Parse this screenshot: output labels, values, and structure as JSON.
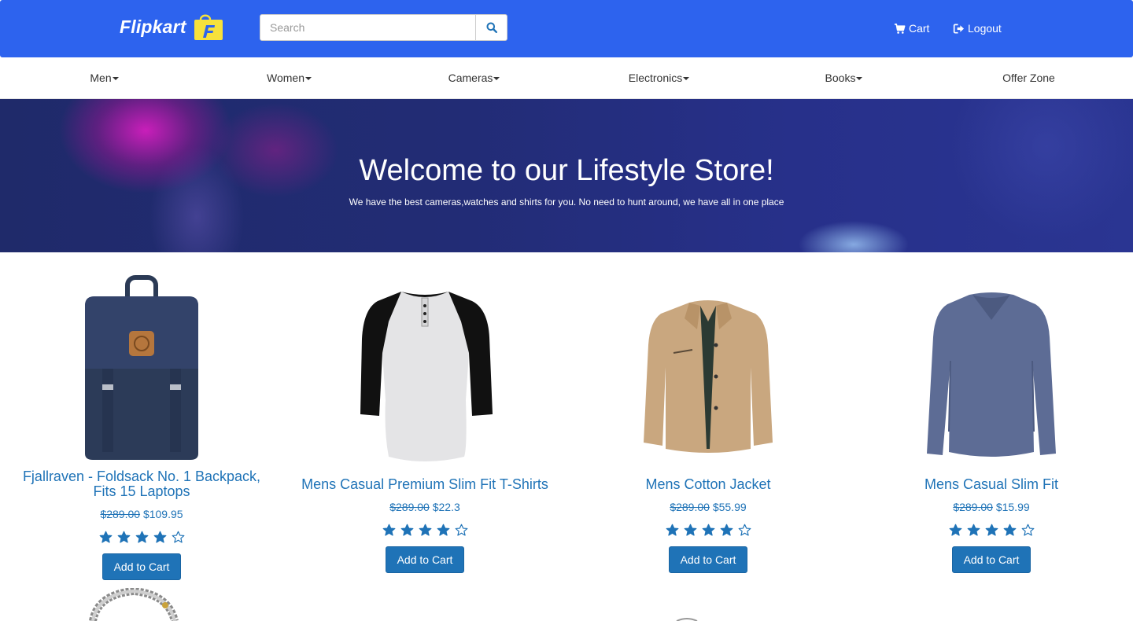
{
  "header": {
    "logo_text": "Flipkart",
    "search_placeholder": "Search",
    "cart_label": "Cart",
    "logout_label": "Logout",
    "brand_color": "#2d63ee"
  },
  "nav": {
    "items": [
      {
        "label": "Men",
        "dropdown": true
      },
      {
        "label": "Women",
        "dropdown": true
      },
      {
        "label": "Cameras",
        "dropdown": true
      },
      {
        "label": "Electronics",
        "dropdown": true
      },
      {
        "label": "Books",
        "dropdown": true
      },
      {
        "label": "Offer Zone",
        "dropdown": false
      }
    ]
  },
  "banner": {
    "title": "Welcome to our Lifestyle Store!",
    "subtitle": "We have the best cameras,watches and shirts for you. No need to hunt around, we have all in one place"
  },
  "products": [
    {
      "name": "Fjallraven - Foldsack No. 1 Backpack, Fits 15 Laptops",
      "old_price": "$289.00",
      "price": "$109.95",
      "rating": 4,
      "button": "Add to Cart",
      "image": "backpack"
    },
    {
      "name": "Mens Casual Premium Slim Fit T-Shirts",
      "old_price": "$289.00",
      "price": "$22.3",
      "rating": 4,
      "button": "Add to Cart",
      "image": "raglan-tshirt"
    },
    {
      "name": "Mens Cotton Jacket",
      "old_price": "$289.00",
      "price": "$55.99",
      "rating": 4,
      "button": "Add to Cart",
      "image": "cotton-jacket"
    },
    {
      "name": "Mens Casual Slim Fit",
      "old_price": "$289.00",
      "price": "$15.99",
      "rating": 4,
      "button": "Add to Cart",
      "image": "slim-fit-sweater"
    }
  ],
  "accent_color": "#1f73b7"
}
